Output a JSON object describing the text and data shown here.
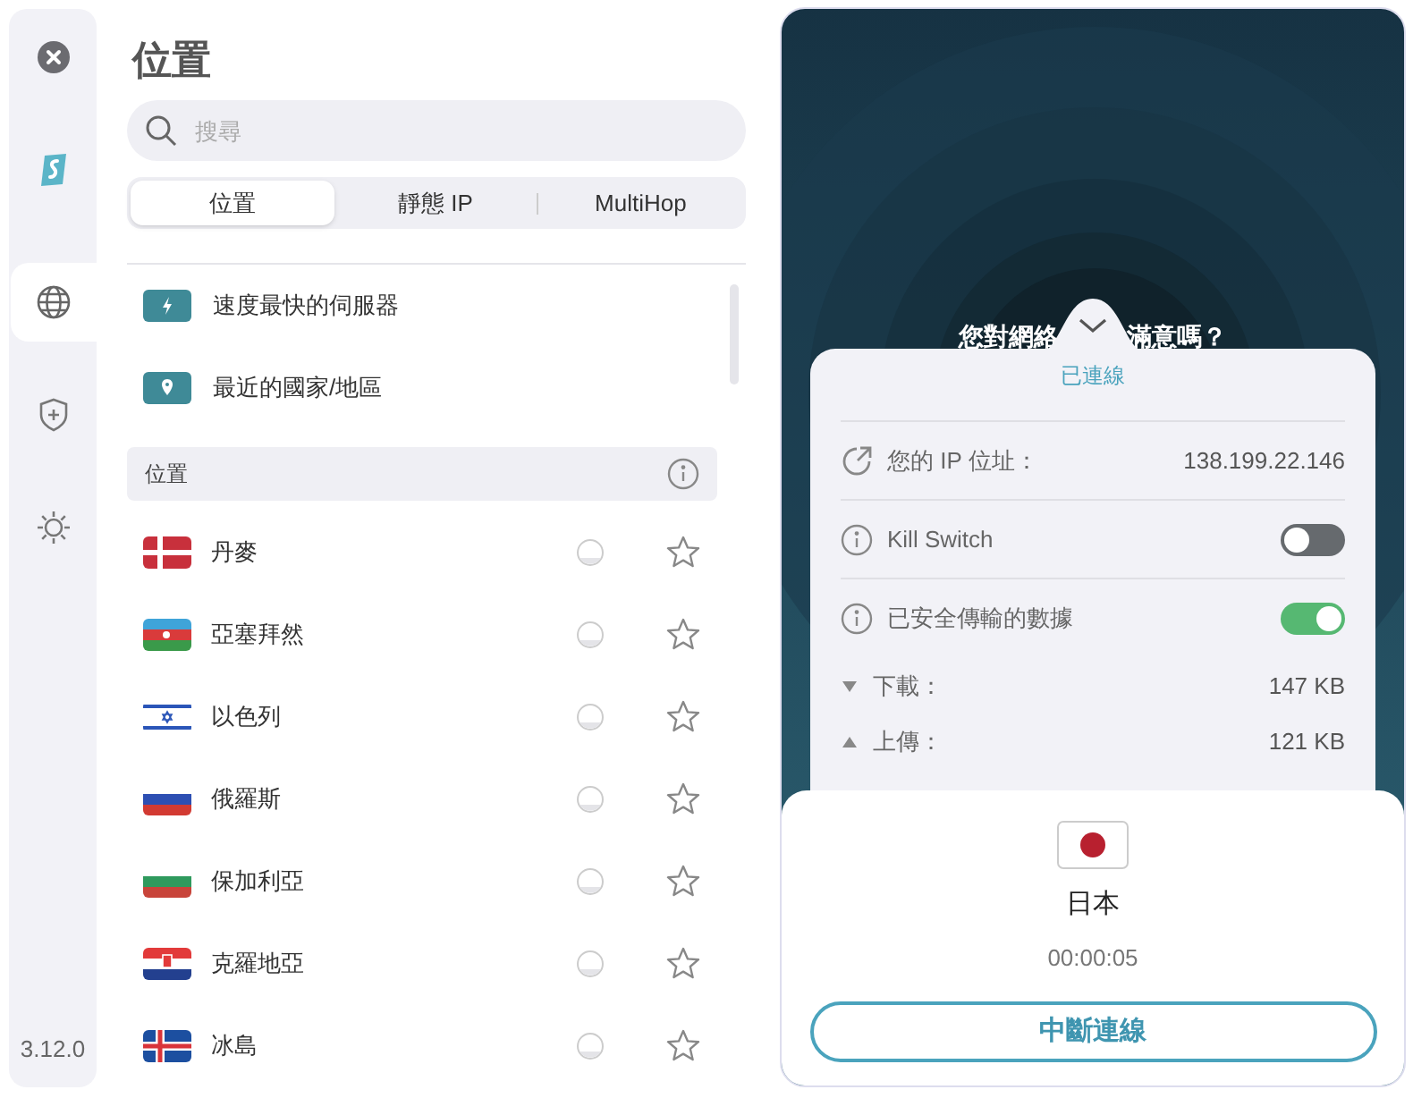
{
  "sidebar": {
    "items": [
      {
        "kind": "close",
        "selected": false
      },
      {
        "kind": "logo",
        "selected": false
      },
      {
        "kind": "globe",
        "selected": true
      },
      {
        "kind": "shield",
        "selected": false
      },
      {
        "kind": "settings",
        "selected": false
      }
    ],
    "version": "3.12.0"
  },
  "title": "位置",
  "search": {
    "placeholder": "搜尋"
  },
  "tabs": [
    {
      "label": "位置",
      "selected": true
    },
    {
      "label": "靜態 IP",
      "selected": false
    },
    {
      "label": "MultiHop",
      "selected": false
    }
  ],
  "quick": [
    {
      "kind": "fastest",
      "label": "速度最快的伺服器"
    },
    {
      "kind": "recent",
      "label": "最近的國家/地區"
    }
  ],
  "section": {
    "title": "位置"
  },
  "countries": [
    {
      "kind": "dk",
      "name": "丹麥",
      "favorite": false
    },
    {
      "kind": "az",
      "name": "亞塞拜然",
      "favorite": false
    },
    {
      "kind": "il",
      "name": "以色列",
      "favorite": false
    },
    {
      "kind": "ru",
      "name": "俄羅斯",
      "favorite": false
    },
    {
      "kind": "bg",
      "name": "保加利亞",
      "favorite": false
    },
    {
      "kind": "hr",
      "name": "克羅地亞",
      "favorite": false
    },
    {
      "kind": "is",
      "name": "冰島",
      "favorite": false
    }
  ],
  "connection": {
    "headline_left": "您對網絡",
    "headline_right": "滿意嗎？",
    "status": "已連線",
    "rows": [
      {
        "kind": "ip",
        "label": "您的 IP 位址：",
        "value": "138.199.22.146"
      },
      {
        "kind": "toggle",
        "label": "Kill Switch",
        "on": false
      },
      {
        "kind": "toggle",
        "label": "已安全傳輸的數據",
        "on": true
      },
      {
        "kind": "down",
        "label": "下載：",
        "value": "147 KB"
      },
      {
        "kind": "up",
        "label": "上傳：",
        "value": "121 KB"
      }
    ],
    "country": "日本",
    "timer": "00:00:05",
    "disconnect": "中斷連線"
  }
}
